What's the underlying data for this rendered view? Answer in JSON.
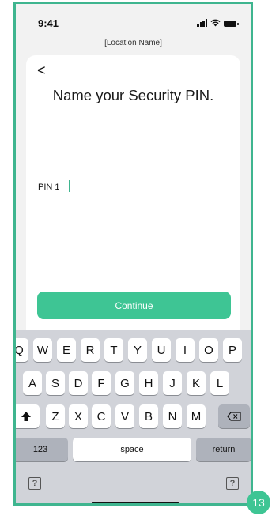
{
  "status_bar": {
    "time": "9:41"
  },
  "header": {
    "location_name": "[Location Name]"
  },
  "card": {
    "back_label": "<",
    "title": "Name your Security PIN.",
    "pin_field": {
      "value": "PIN 1"
    },
    "continue_label": "Continue"
  },
  "keyboard": {
    "row1": [
      "Q",
      "W",
      "E",
      "R",
      "T",
      "Y",
      "U",
      "I",
      "O",
      "P"
    ],
    "row2": [
      "A",
      "S",
      "D",
      "F",
      "G",
      "H",
      "J",
      "K",
      "L"
    ],
    "row3": [
      "Z",
      "X",
      "C",
      "V",
      "B",
      "N",
      "M"
    ],
    "numbers_label": "123",
    "space_label": "space",
    "return_label": "return",
    "help_label": "?"
  },
  "step_badge": "13",
  "colors": {
    "accent": "#3ec594",
    "frame": "#3fb58f",
    "keyboard_bg": "#d1d3d9"
  },
  "icons": [
    "signal-icon",
    "wifi-icon",
    "battery-icon",
    "shift-icon",
    "backspace-icon",
    "help-icon"
  ]
}
